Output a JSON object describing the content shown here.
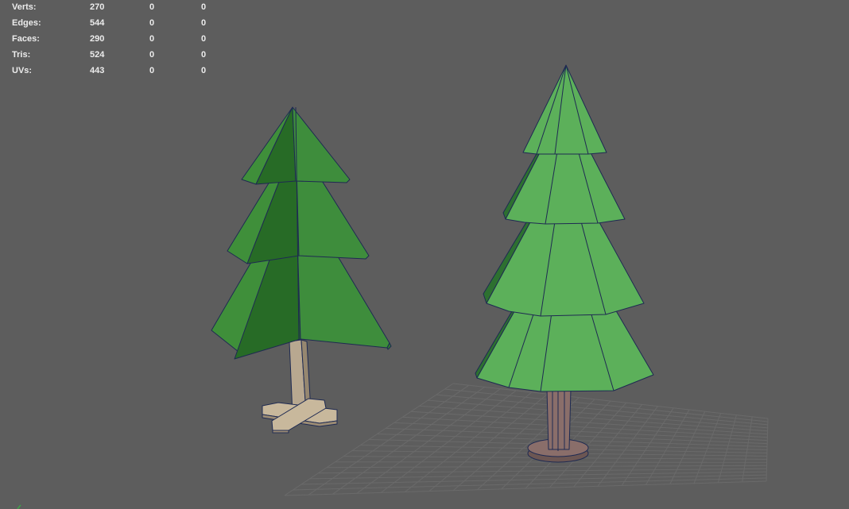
{
  "hud": {
    "rows": [
      {
        "label": "Verts:",
        "values": [
          "270",
          "0",
          "0"
        ]
      },
      {
        "label": "Edges:",
        "values": [
          "544",
          "0",
          "0"
        ]
      },
      {
        "label": "Faces:",
        "values": [
          "290",
          "0",
          "0"
        ]
      },
      {
        "label": "Tris:",
        "values": [
          "524",
          "0",
          "0"
        ]
      },
      {
        "label": "UVs:",
        "values": [
          "443",
          "0",
          "0"
        ]
      }
    ]
  },
  "colors": {
    "background": "#5d5d5d",
    "hud_text": "#ececec",
    "grid": "#6a6a6a",
    "wireframe": "#1e2a52",
    "tree_left_foliage": "#3f8f3a",
    "tree_left_foliage_shadow": "#276b26",
    "tree_left_trunk": "#b8a890",
    "tree_right_foliage": "#5cb05a",
    "tree_right_foliage_shadow": "#2d7030",
    "tree_right_trunk": "#8a6e6a"
  }
}
